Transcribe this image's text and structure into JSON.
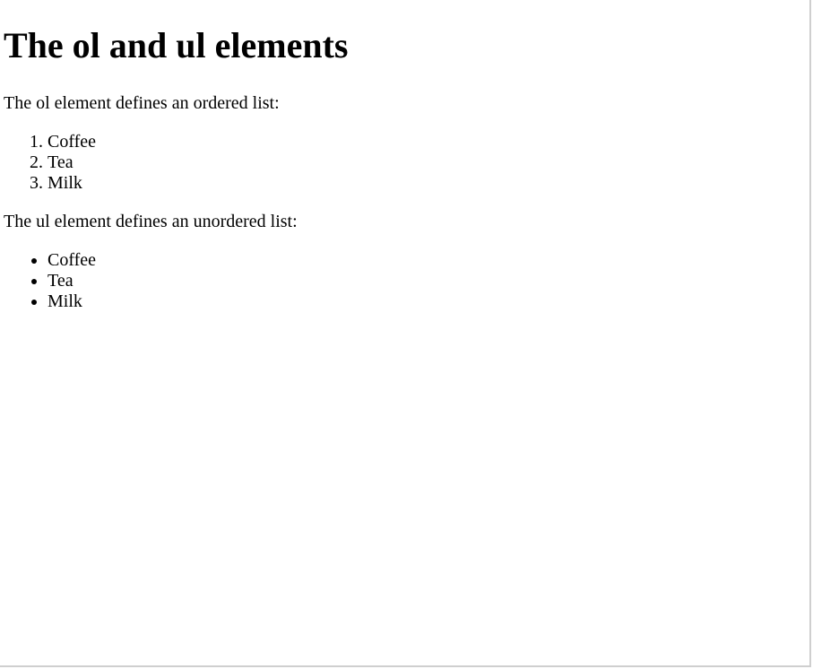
{
  "heading": "The ol and ul elements",
  "ol_intro": "The ol element defines an ordered list:",
  "ol_items": [
    "Coffee",
    "Tea",
    "Milk"
  ],
  "ul_intro": "The ul element defines an unordered list:",
  "ul_items": [
    "Coffee",
    "Tea",
    "Milk"
  ]
}
